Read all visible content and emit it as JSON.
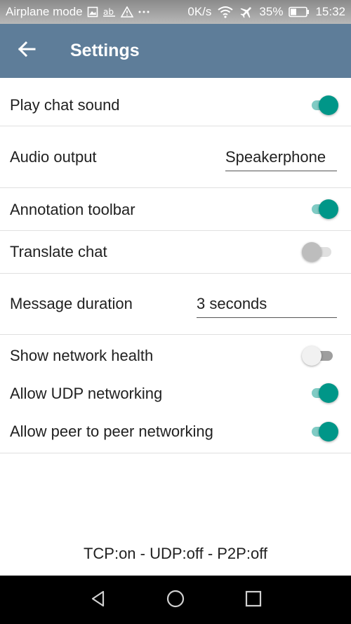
{
  "status_bar": {
    "left_text": "Airplane mode",
    "network_speed": "0K/s",
    "battery_percent": "35%",
    "time": "15:32",
    "icons": [
      "image-icon",
      "ab-icon",
      "warning-icon",
      "more-dots-icon",
      "wifi-icon",
      "airplane-icon",
      "battery-icon"
    ],
    "text_color": "#ffffff"
  },
  "app_bar": {
    "title": "Settings",
    "back_icon": "arrow-left-icon",
    "background_color": "#5e7d99"
  },
  "settings": {
    "play_chat_sound": {
      "label": "Play chat sound",
      "enabled": true
    },
    "audio_output": {
      "label": "Audio output",
      "value": "Speakerphone"
    },
    "annotation_toolbar": {
      "label": "Annotation toolbar",
      "enabled": true
    },
    "translate_chat": {
      "label": "Translate chat",
      "enabled": false
    },
    "message_duration": {
      "label": "Message duration",
      "value": "3 seconds"
    },
    "show_network_health": {
      "label": "Show network health",
      "enabled": false
    },
    "allow_udp": {
      "label": "Allow UDP networking",
      "enabled": true
    },
    "allow_p2p": {
      "label": "Allow peer to peer networking",
      "enabled": true
    }
  },
  "footer": {
    "connection_status": "TCP:on - UDP:off - P2P:off"
  },
  "nav_bar": {
    "icons": [
      "back-triangle-icon",
      "home-circle-icon",
      "recents-square-icon"
    ]
  },
  "colors": {
    "accent": "#009688",
    "accent_track": "#80cbc4",
    "divider": "#e0e0e0"
  }
}
